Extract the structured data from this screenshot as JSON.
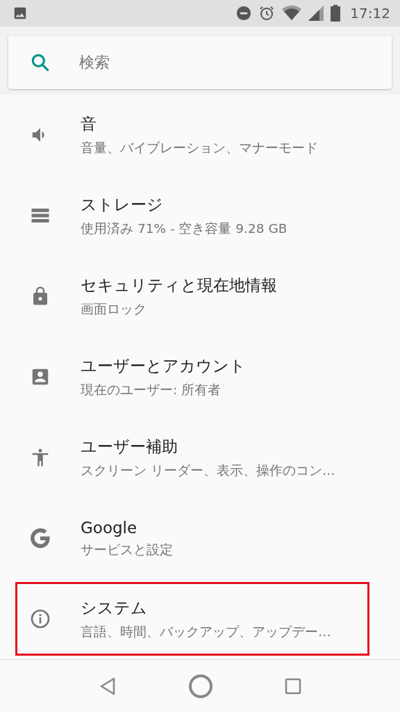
{
  "status_bar": {
    "time": "17:12"
  },
  "search": {
    "placeholder": "検索"
  },
  "items": [
    {
      "title": "音",
      "subtitle": "音量、バイブレーション、マナーモード",
      "highlighted": false
    },
    {
      "title": "ストレージ",
      "subtitle": "使用済み 71% - 空き容量 9.28 GB",
      "highlighted": false
    },
    {
      "title": "セキュリティと現在地情報",
      "subtitle": "画面ロック",
      "highlighted": false
    },
    {
      "title": "ユーザーとアカウント",
      "subtitle": "現在のユーザー: 所有者",
      "highlighted": false
    },
    {
      "title": "ユーザー補助",
      "subtitle": "スクリーン リーダー、表示、操作のコン…",
      "highlighted": false
    },
    {
      "title": "Google",
      "subtitle": "サービスと設定",
      "highlighted": false
    },
    {
      "title": "システム",
      "subtitle": "言語、時間、バックアップ、アップデー…",
      "highlighted": true
    }
  ]
}
